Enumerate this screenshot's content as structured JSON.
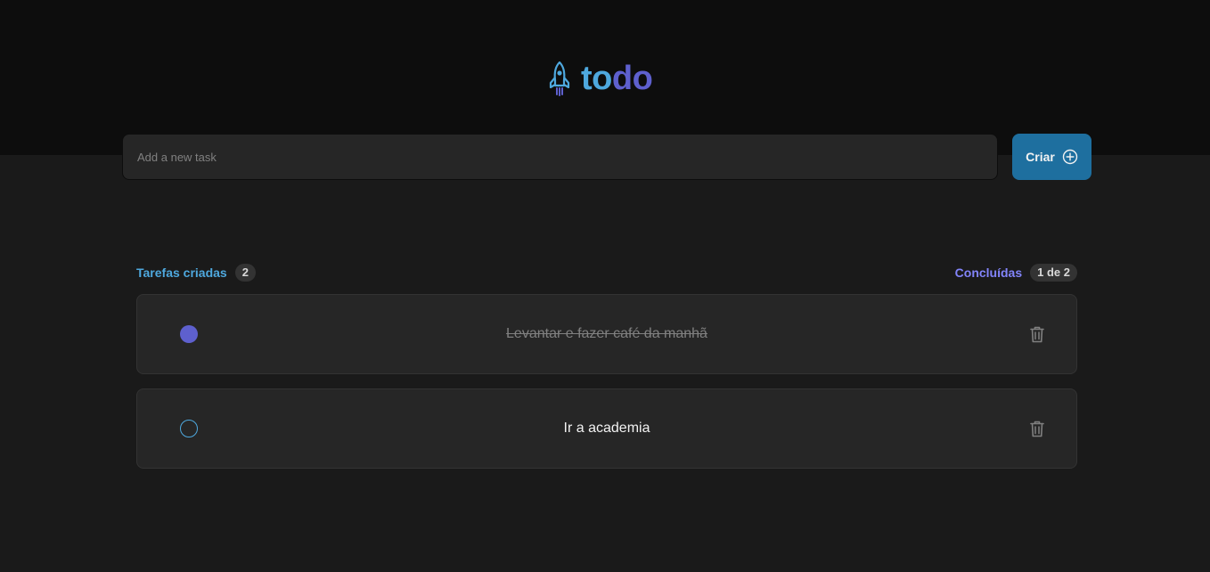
{
  "app": {
    "title_part1": "to",
    "title_part2": "do",
    "logo_icon": "rocket-icon"
  },
  "new_task": {
    "placeholder": "Add a new task",
    "value": "",
    "create_label": "Criar",
    "create_icon": "plus-circle-icon"
  },
  "counters": {
    "created_label": "Tarefas criadas",
    "created_count": "2",
    "done_label": "Concluídas",
    "done_count": "1 de 2"
  },
  "tasks": [
    {
      "text": "Levantar e fazer café da manhã",
      "completed": true
    },
    {
      "text": "Ir a academia",
      "completed": false
    }
  ],
  "colors": {
    "blue": "#4ea8de",
    "purple": "#5e60ce",
    "purple_light": "#8284fa",
    "button": "#1e6f9f"
  }
}
